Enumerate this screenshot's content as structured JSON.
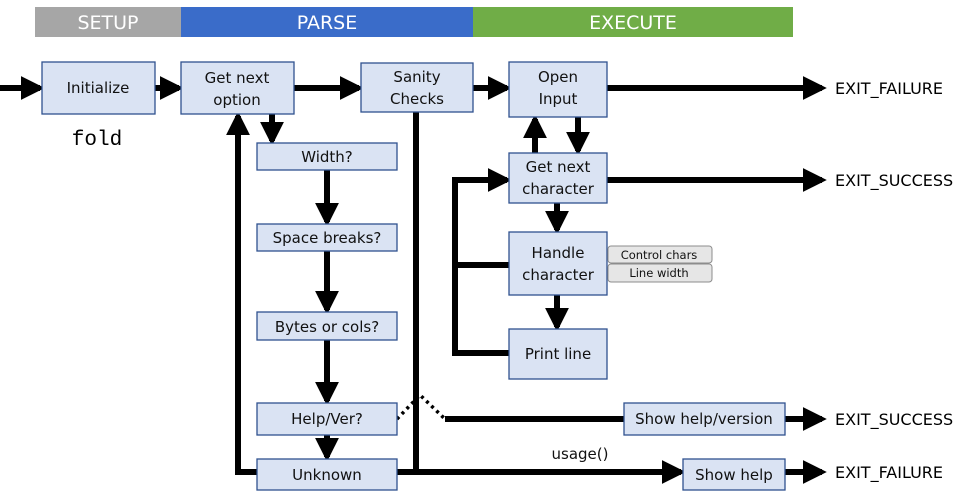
{
  "phases": {
    "setup": "SETUP",
    "parse": "PARSE",
    "execute": "EXECUTE",
    "colors": {
      "setup": "#a6a6a6",
      "parse": "#3a6cc9",
      "execute": "#70ad47"
    }
  },
  "program_name": "fold",
  "boxes": {
    "initialize": "Initialize",
    "get_next_option": [
      "Get next",
      "option"
    ],
    "sanity_checks": [
      "Sanity",
      "Checks"
    ],
    "open_input": [
      "Open",
      "Input"
    ],
    "get_next_character": [
      "Get next",
      "character"
    ],
    "handle_character": [
      "Handle",
      "character"
    ],
    "print_line": "Print line",
    "width": "Width?",
    "space_breaks": "Space breaks?",
    "bytes_or_cols": "Bytes or cols?",
    "help_ver": "Help/Ver?",
    "unknown": "Unknown",
    "show_help_version": "Show help/version",
    "show_help": "Show help"
  },
  "tags": {
    "control_chars": "Control chars",
    "line_width": "Line width"
  },
  "exits": {
    "failure_1": "EXIT_FAILURE",
    "success_1": "EXIT_SUCCESS",
    "success_2": "EXIT_SUCCESS",
    "failure_2": "EXIT_FAILURE"
  },
  "edge_labels": {
    "usage": "usage()"
  }
}
